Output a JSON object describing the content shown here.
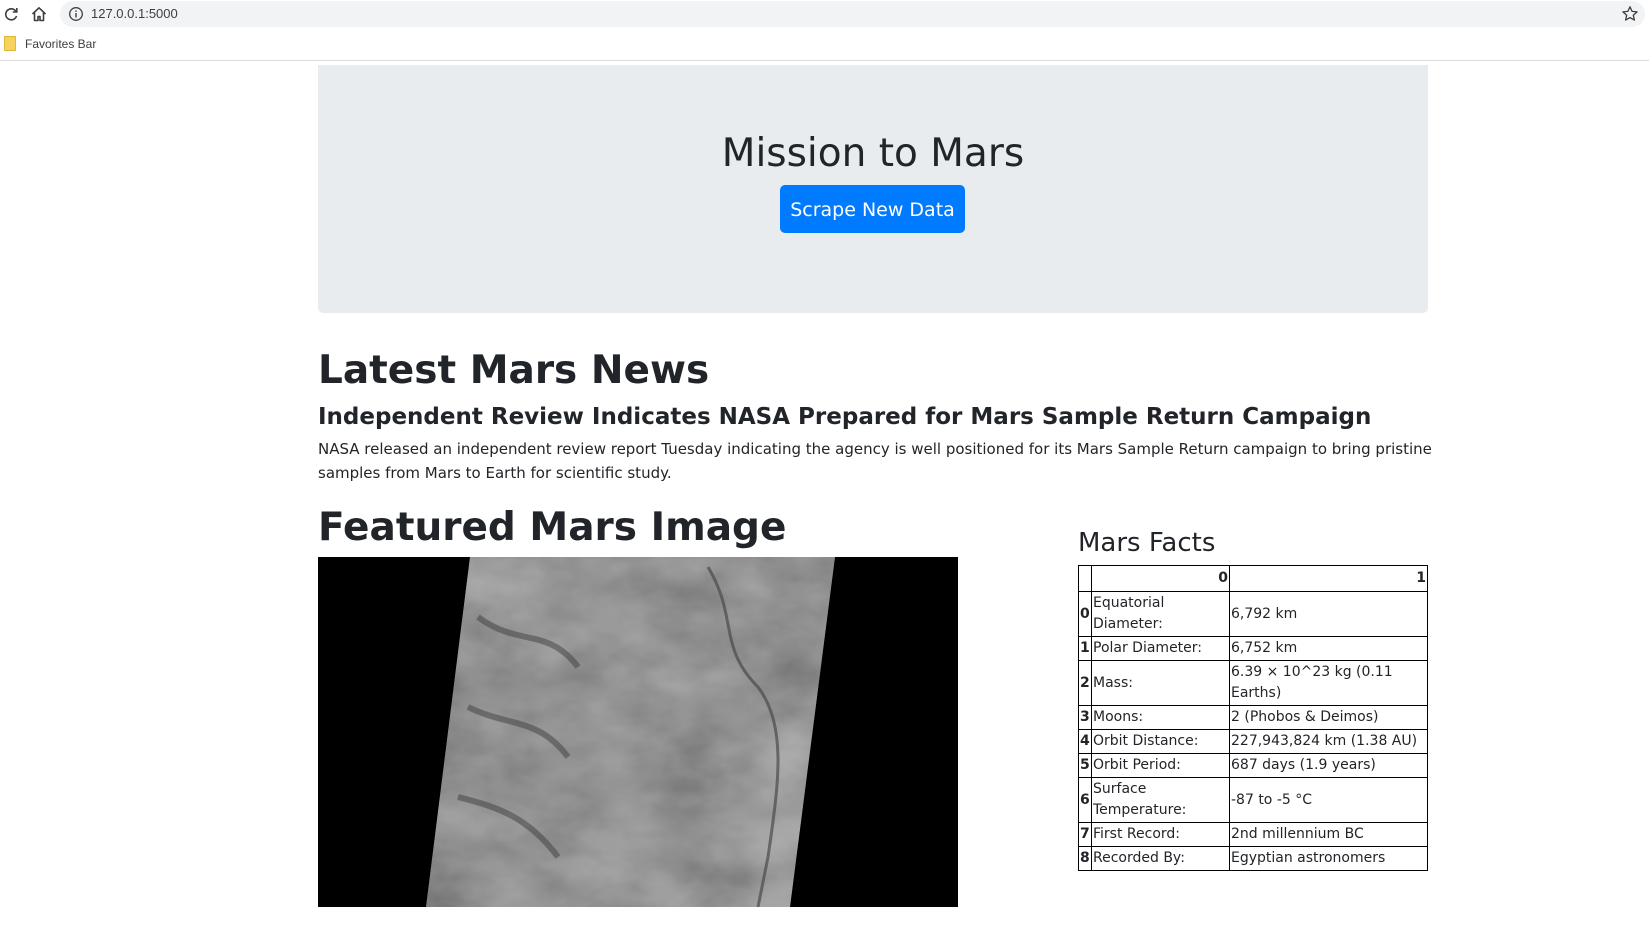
{
  "browser": {
    "url": "127.0.0.1:5000",
    "favorites_bar": {
      "items": [
        {
          "label": "Favorites Bar"
        }
      ]
    }
  },
  "hero": {
    "title": "Mission to Mars",
    "button_label": "Scrape New Data",
    "colors": {
      "background": "#e9ecef",
      "button": "#007bff"
    }
  },
  "news": {
    "heading": "Latest Mars News",
    "title": "Independent Review Indicates NASA Prepared for Mars Sample Return Campaign",
    "paragraph": "NASA released an independent review report Tuesday indicating the agency is well positioned for its Mars Sample Return campaign to bring pristine samples from Mars to Earth for scientific study."
  },
  "featured": {
    "heading": "Featured Mars Image"
  },
  "facts": {
    "heading": "Mars Facts",
    "columns": [
      "",
      "0",
      "1"
    ],
    "rows": [
      {
        "index": "0",
        "label": "Equatorial Diameter:",
        "value": "6,792 km"
      },
      {
        "index": "1",
        "label": "Polar Diameter:",
        "value": "6,752 km"
      },
      {
        "index": "2",
        "label": "Mass:",
        "value": "6.39 × 10^23 kg (0.11 Earths)"
      },
      {
        "index": "3",
        "label": "Moons:",
        "value": "2 (Phobos & Deimos)"
      },
      {
        "index": "4",
        "label": "Orbit Distance:",
        "value": "227,943,824 km (1.38 AU)"
      },
      {
        "index": "5",
        "label": "Orbit Period:",
        "value": "687 days (1.9 years)"
      },
      {
        "index": "6",
        "label": "Surface Temperature:",
        "value": "-87 to -5 °C"
      },
      {
        "index": "7",
        "label": "First Record:",
        "value": "2nd millennium BC"
      },
      {
        "index": "8",
        "label": "Recorded By:",
        "value": "Egyptian astronomers"
      }
    ]
  }
}
